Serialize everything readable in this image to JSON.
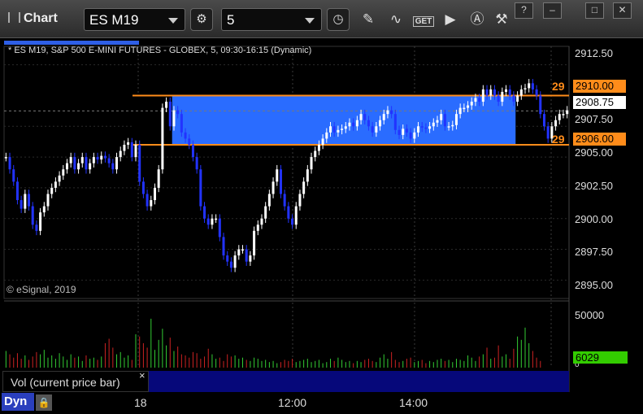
{
  "toolbar": {
    "title": "Chart",
    "symbol": "ES M19",
    "interval": "5",
    "get_label": "GET"
  },
  "window_buttons": {
    "help": "?",
    "minimize": "–",
    "maximize": "□",
    "close": "✕"
  },
  "chart_title": "* ES M19, S&P 500 E-MINI FUTURES - GLOBEX, 5, 09:30-16:15 (Dynamic)",
  "watermark": "© eSignal, 2019",
  "price_panel": {
    "level_high": {
      "label": "29",
      "price": "2910.00"
    },
    "level_low": {
      "label": "29",
      "price": "2906.00"
    },
    "last_price": "2908.75",
    "y_ticks": [
      "2912.50",
      "2907.50",
      "2905.00",
      "2902.50",
      "2900.00",
      "2897.50",
      "2895.00"
    ]
  },
  "volume_panel": {
    "label": "Vol (current price bar)",
    "close_glyph": "×",
    "tick": "50000",
    "zero_tick": "0",
    "last_volume": "6029"
  },
  "x_axis": {
    "ticks": [
      "18",
      "12:00",
      "14:00"
    ]
  },
  "footer": {
    "mode": "Dyn"
  },
  "colors": {
    "up": "#ffffff",
    "down": "#2233ff",
    "range_fill": "#2a6cff",
    "level": "#ff8c1a",
    "vol_up": "#33cc33",
    "vol_down": "#cc2222",
    "accent": "#2e5fe6"
  },
  "chart_data": {
    "type": "candlestick",
    "title": "ES M19, S&P 500 E-MINI FUTURES - GLOBEX, 5, 09:30-16:15 (Dynamic)",
    "ylim": [
      2893.5,
      2914.0
    ],
    "range_box": {
      "from_bar": 44,
      "to_bar": 134,
      "high": 2910.0,
      "low": 2906.0
    },
    "reference_lines": [
      2910.0,
      2906.0
    ],
    "last_price": 2908.75,
    "closes": [
      2905.0,
      2904.0,
      2903.0,
      2901.5,
      2900.8,
      2902.0,
      2901.0,
      2899.5,
      2899.0,
      2900.5,
      2901.0,
      2902.0,
      2902.5,
      2903.0,
      2903.5,
      2904.0,
      2904.5,
      2905.0,
      2904.0,
      2904.5,
      2905.0,
      2904.0,
      2904.5,
      2905.0,
      2904.8,
      2905.1,
      2904.9,
      2904.5,
      2904.0,
      2905.0,
      2905.5,
      2906.0,
      2906.2,
      2905.0,
      2906.0,
      2903.0,
      2902.0,
      2901.0,
      2901.5,
      2902.5,
      2904.0,
      2909.0,
      2909.5,
      2907.5,
      2908.8,
      2908.5,
      2907.0,
      2906.5,
      2906.0,
      2905.0,
      2904.0,
      2901.0,
      2900.0,
      2899.5,
      2900.0,
      2900.0,
      2898.5,
      2897.0,
      2896.5,
      2896.0,
      2897.0,
      2897.5,
      2897.5,
      2896.5,
      2897.0,
      2899.0,
      2899.5,
      2900.0,
      2901.0,
      2902.0,
      2903.0,
      2904.0,
      2902.0,
      2901.0,
      2900.0,
      2899.5,
      2901.0,
      2902.0,
      2903.0,
      2904.0,
      2905.0,
      2905.5,
      2906.0,
      2906.5,
      2907.0,
      2907.5,
      2907.0,
      2907.2,
      2907.3,
      2907.5,
      2907.8,
      2907.5,
      2908.0,
      2908.5,
      2908.0,
      2907.5,
      2907.0,
      2907.5,
      2908.0,
      2908.5,
      2908.8,
      2908.5,
      2907.2,
      2906.8,
      2907.3,
      2907.0,
      2906.5,
      2907.0,
      2907.5,
      2907.4,
      2907.3,
      2907.5,
      2907.8,
      2908.0,
      2908.5,
      2907.5,
      2907.5,
      2907.6,
      2908.5,
      2909.0,
      2909.0,
      2909.2,
      2909.5,
      2909.8,
      2909.5,
      2910.5,
      2910.0,
      2910.5,
      2910.0,
      2909.5,
      2910.3,
      2910.5,
      2910.0,
      2909.5,
      2910.0,
      2910.5,
      2910.6,
      2911.0,
      2910.5,
      2910.0,
      2908.5,
      2907.5,
      2906.5,
      2907.5,
      2908.0,
      2908.5,
      2908.5,
      2908.8
    ],
    "volume_ylim": [
      0,
      60000
    ],
    "volume_step": 1,
    "volumes": [
      15000,
      12000,
      9000,
      13000,
      8000,
      11000,
      7000,
      10000,
      14000,
      12000,
      16000,
      9000,
      11000,
      8000,
      13000,
      10000,
      7000,
      12000,
      9000,
      10000,
      6000,
      11000,
      8000,
      9000,
      7000,
      10000,
      22000,
      26000,
      18000,
      12000,
      14000,
      9000,
      11000,
      7000,
      30000,
      28000,
      22000,
      18000,
      44000,
      16000,
      25000,
      35000,
      20000,
      27000,
      15000,
      19000,
      12000,
      11000,
      9000,
      14000,
      13000,
      8000,
      10000,
      17000,
      12000,
      8000,
      9000,
      6000,
      12000,
      10000,
      11000,
      8000,
      9000,
      7000,
      6000,
      9000,
      8000,
      6000,
      7000,
      5000,
      6000,
      4000,
      5000,
      7000,
      6000,
      8000,
      5000,
      6000,
      7000,
      8000,
      5000,
      6000,
      7000,
      4000,
      5000,
      8000,
      6000,
      9000,
      7000,
      5000,
      6000,
      4000,
      6000,
      5000,
      7000,
      8000,
      6000,
      5000,
      9000,
      12000,
      8000,
      14000,
      7000,
      5000,
      6000,
      8000,
      9000,
      5000,
      6000,
      7000,
      4000,
      6000,
      5000,
      7000,
      8000,
      6000,
      7000,
      5000,
      8000,
      7000,
      6000,
      11000,
      9000,
      6000,
      10000,
      12000,
      18000,
      8000,
      9000,
      20000,
      10000,
      12000,
      8000,
      17000,
      28000,
      25000,
      36000,
      22000,
      15000,
      9000,
      6029
    ]
  }
}
